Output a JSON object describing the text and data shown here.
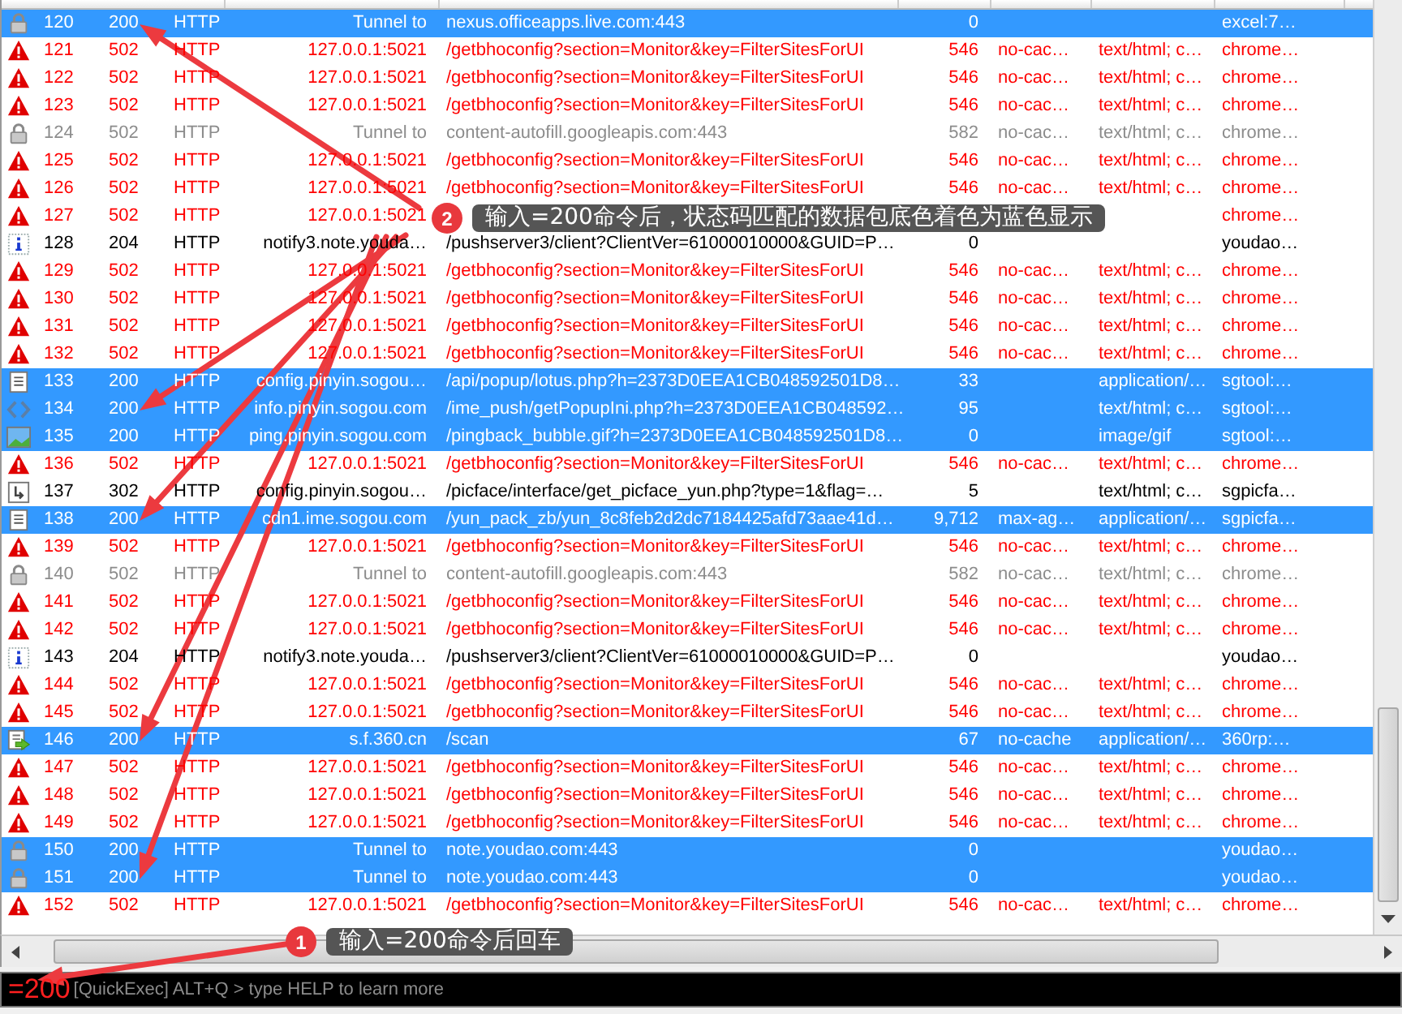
{
  "sessions": [
    {
      "kind": "lock",
      "error": false,
      "dimmed": false,
      "selected": true,
      "id": "120",
      "result": "200",
      "protocol": "HTTP",
      "host": "Tunnel to",
      "url": "nexus.officeapps.live.com:443",
      "body": "0",
      "process": "excel:7…"
    },
    {
      "kind": "warning",
      "error": true,
      "dimmed": false,
      "selected": false,
      "id": "121",
      "result": "502",
      "protocol": "HTTP",
      "host": "127.0.0.1:5021",
      "url": "/getbhoconfig?section=Monitor&key=FilterSitesForUI",
      "body": "546",
      "caching": "no-cac…",
      "content_type": "text/html; c…",
      "process": "chrome…"
    },
    {
      "kind": "warning",
      "error": true,
      "dimmed": false,
      "selected": false,
      "id": "122",
      "result": "502",
      "protocol": "HTTP",
      "host": "127.0.0.1:5021",
      "url": "/getbhoconfig?section=Monitor&key=FilterSitesForUI",
      "body": "546",
      "caching": "no-cac…",
      "content_type": "text/html; c…",
      "process": "chrome…"
    },
    {
      "kind": "warning",
      "error": true,
      "dimmed": false,
      "selected": false,
      "id": "123",
      "result": "502",
      "protocol": "HTTP",
      "host": "127.0.0.1:5021",
      "url": "/getbhoconfig?section=Monitor&key=FilterSitesForUI",
      "body": "546",
      "caching": "no-cac…",
      "content_type": "text/html; c…",
      "process": "chrome…"
    },
    {
      "kind": "lock",
      "error": false,
      "dimmed": true,
      "selected": false,
      "id": "124",
      "result": "502",
      "protocol": "HTTP",
      "host": "Tunnel to",
      "url": "content-autofill.googleapis.com:443",
      "body": "582",
      "caching": "no-cac…",
      "content_type": "text/html; c…",
      "process": "chrome…"
    },
    {
      "kind": "warning",
      "error": true,
      "dimmed": false,
      "selected": false,
      "id": "125",
      "result": "502",
      "protocol": "HTTP",
      "host": "127.0.0.1:5021",
      "url": "/getbhoconfig?section=Monitor&key=FilterSitesForUI",
      "body": "546",
      "caching": "no-cac…",
      "content_type": "text/html; c…",
      "process": "chrome…"
    },
    {
      "kind": "warning",
      "error": true,
      "dimmed": false,
      "selected": false,
      "id": "126",
      "result": "502",
      "protocol": "HTTP",
      "host": "127.0.0.1:5021",
      "url": "/getbhoconfig?section=Monitor&key=FilterSitesForUI",
      "body": "546",
      "caching": "no-cac…",
      "content_type": "text/html; c…",
      "process": "chrome…"
    },
    {
      "kind": "warning",
      "error": true,
      "dimmed": false,
      "selected": false,
      "id": "127",
      "result": "502",
      "protocol": "HTTP",
      "host": "127.0.0.1:5021",
      "process": "chrome…"
    },
    {
      "kind": "info",
      "error": false,
      "dimmed": false,
      "selected": false,
      "id": "128",
      "result": "204",
      "protocol": "HTTP",
      "host": "notify3.note.youda…",
      "url": "/pushserver3/client?ClientVer=61000010000&GUID=P…",
      "body": "0",
      "process": "youdao…"
    },
    {
      "kind": "warning",
      "error": true,
      "dimmed": false,
      "selected": false,
      "id": "129",
      "result": "502",
      "protocol": "HTTP",
      "host": "127.0.0.1:5021",
      "url": "/getbhoconfig?section=Monitor&key=FilterSitesForUI",
      "body": "546",
      "caching": "no-cac…",
      "content_type": "text/html; c…",
      "process": "chrome…"
    },
    {
      "kind": "warning",
      "error": true,
      "dimmed": false,
      "selected": false,
      "id": "130",
      "result": "502",
      "protocol": "HTTP",
      "host": "127.0.0.1:5021",
      "url": "/getbhoconfig?section=Monitor&key=FilterSitesForUI",
      "body": "546",
      "caching": "no-cac…",
      "content_type": "text/html; c…",
      "process": "chrome…"
    },
    {
      "kind": "warning",
      "error": true,
      "dimmed": false,
      "selected": false,
      "id": "131",
      "result": "502",
      "protocol": "HTTP",
      "host": "127.0.0.1:5021",
      "url": "/getbhoconfig?section=Monitor&key=FilterSitesForUI",
      "body": "546",
      "caching": "no-cac…",
      "content_type": "text/html; c…",
      "process": "chrome…"
    },
    {
      "kind": "warning",
      "error": true,
      "dimmed": false,
      "selected": false,
      "id": "132",
      "result": "502",
      "protocol": "HTTP",
      "host": "127.0.0.1:5021",
      "url": "/getbhoconfig?section=Monitor&key=FilterSitesForUI",
      "body": "546",
      "caching": "no-cac…",
      "content_type": "text/html; c…",
      "process": "chrome…"
    },
    {
      "kind": "document",
      "error": false,
      "dimmed": false,
      "selected": true,
      "id": "133",
      "result": "200",
      "protocol": "HTTP",
      "host": "config.pinyin.sogou…",
      "url": "/api/popup/lotus.php?h=2373D0EEA1CB048592501D8…",
      "body": "33",
      "content_type": "application/…",
      "process": "sgtool:…"
    },
    {
      "kind": "code",
      "error": false,
      "dimmed": false,
      "selected": true,
      "id": "134",
      "result": "200",
      "protocol": "HTTP",
      "host": "info.pinyin.sogou.com",
      "url": "/ime_push/getPopupIni.php?h=2373D0EEA1CB048592…",
      "body": "95",
      "content_type": "text/html; c…",
      "process": "sgtool:…"
    },
    {
      "kind": "image",
      "error": false,
      "dimmed": false,
      "selected": true,
      "id": "135",
      "result": "200",
      "protocol": "HTTP",
      "host": "ping.pinyin.sogou.com",
      "url": "/pingback_bubble.gif?h=2373D0EEA1CB048592501D8…",
      "body": "0",
      "content_type": "image/gif",
      "process": "sgtool:…"
    },
    {
      "kind": "warning",
      "error": true,
      "dimmed": false,
      "selected": false,
      "id": "136",
      "result": "502",
      "protocol": "HTTP",
      "host": "127.0.0.1:5021",
      "url": "/getbhoconfig?section=Monitor&key=FilterSitesForUI",
      "body": "546",
      "caching": "no-cac…",
      "content_type": "text/html; c…",
      "process": "chrome…"
    },
    {
      "kind": "redirect",
      "error": false,
      "dimmed": false,
      "selected": false,
      "id": "137",
      "result": "302",
      "protocol": "HTTP",
      "host": "config.pinyin.sogou…",
      "url": "/picface/interface/get_picface_yun.php?type=1&flag=…",
      "body": "5",
      "content_type": "text/html; c…",
      "process": "sgpicfa…"
    },
    {
      "kind": "document",
      "error": false,
      "dimmed": false,
      "selected": true,
      "id": "138",
      "result": "200",
      "protocol": "HTTP",
      "host": "cdn1.ime.sogou.com",
      "url": "/yun_pack_zb/yun_8c8feb2d2dc7184425afd73aae41d…",
      "body": "9,712",
      "caching": "max-ag…",
      "content_type": "application/…",
      "process": "sgpicfa…"
    },
    {
      "kind": "warning",
      "error": true,
      "dimmed": false,
      "selected": false,
      "id": "139",
      "result": "502",
      "protocol": "HTTP",
      "host": "127.0.0.1:5021",
      "url": "/getbhoconfig?section=Monitor&key=FilterSitesForUI",
      "body": "546",
      "caching": "no-cac…",
      "content_type": "text/html; c…",
      "process": "chrome…"
    },
    {
      "kind": "lock",
      "error": false,
      "dimmed": true,
      "selected": false,
      "id": "140",
      "result": "502",
      "protocol": "HTTP",
      "host": "Tunnel to",
      "url": "content-autofill.googleapis.com:443",
      "body": "582",
      "caching": "no-cac…",
      "content_type": "text/html; c…",
      "process": "chrome…"
    },
    {
      "kind": "warning",
      "error": true,
      "dimmed": false,
      "selected": false,
      "id": "141",
      "result": "502",
      "protocol": "HTTP",
      "host": "127.0.0.1:5021",
      "url": "/getbhoconfig?section=Monitor&key=FilterSitesForUI",
      "body": "546",
      "caching": "no-cac…",
      "content_type": "text/html; c…",
      "process": "chrome…"
    },
    {
      "kind": "warning",
      "error": true,
      "dimmed": false,
      "selected": false,
      "id": "142",
      "result": "502",
      "protocol": "HTTP",
      "host": "127.0.0.1:5021",
      "url": "/getbhoconfig?section=Monitor&key=FilterSitesForUI",
      "body": "546",
      "caching": "no-cac…",
      "content_type": "text/html; c…",
      "process": "chrome…"
    },
    {
      "kind": "info",
      "error": false,
      "dimmed": false,
      "selected": false,
      "id": "143",
      "result": "204",
      "protocol": "HTTP",
      "host": "notify3.note.youda…",
      "url": "/pushserver3/client?ClientVer=61000010000&GUID=P…",
      "body": "0",
      "process": "youdao…"
    },
    {
      "kind": "warning",
      "error": true,
      "dimmed": false,
      "selected": false,
      "id": "144",
      "result": "502",
      "protocol": "HTTP",
      "host": "127.0.0.1:5021",
      "url": "/getbhoconfig?section=Monitor&key=FilterSitesForUI",
      "body": "546",
      "caching": "no-cac…",
      "content_type": "text/html; c…",
      "process": "chrome…"
    },
    {
      "kind": "warning",
      "error": true,
      "dimmed": false,
      "selected": false,
      "id": "145",
      "result": "502",
      "protocol": "HTTP",
      "host": "127.0.0.1:5021",
      "url": "/getbhoconfig?section=Monitor&key=FilterSitesForUI",
      "body": "546",
      "caching": "no-cac…",
      "content_type": "text/html; c…",
      "process": "chrome…"
    },
    {
      "kind": "script",
      "error": false,
      "dimmed": false,
      "selected": true,
      "id": "146",
      "result": "200",
      "protocol": "HTTP",
      "host": "s.f.360.cn",
      "url": "/scan",
      "body": "67",
      "caching": "no-cache",
      "content_type": "application/…",
      "process": "360rp:…"
    },
    {
      "kind": "warning",
      "error": true,
      "dimmed": false,
      "selected": false,
      "id": "147",
      "result": "502",
      "protocol": "HTTP",
      "host": "127.0.0.1:5021",
      "url": "/getbhoconfig?section=Monitor&key=FilterSitesForUI",
      "body": "546",
      "caching": "no-cac…",
      "content_type": "text/html; c…",
      "process": "chrome…"
    },
    {
      "kind": "warning",
      "error": true,
      "dimmed": false,
      "selected": false,
      "id": "148",
      "result": "502",
      "protocol": "HTTP",
      "host": "127.0.0.1:5021",
      "url": "/getbhoconfig?section=Monitor&key=FilterSitesForUI",
      "body": "546",
      "caching": "no-cac…",
      "content_type": "text/html; c…",
      "process": "chrome…"
    },
    {
      "kind": "warning",
      "error": true,
      "dimmed": false,
      "selected": false,
      "id": "149",
      "result": "502",
      "protocol": "HTTP",
      "host": "127.0.0.1:5021",
      "url": "/getbhoconfig?section=Monitor&key=FilterSitesForUI",
      "body": "546",
      "caching": "no-cac…",
      "content_type": "text/html; c…",
      "process": "chrome…"
    },
    {
      "kind": "lock",
      "error": false,
      "dimmed": false,
      "selected": true,
      "id": "150",
      "result": "200",
      "protocol": "HTTP",
      "host": "Tunnel to",
      "url": "note.youdao.com:443",
      "body": "0",
      "process": "youdao…"
    },
    {
      "kind": "lock",
      "error": false,
      "dimmed": false,
      "selected": true,
      "id": "151",
      "result": "200",
      "protocol": "HTTP",
      "host": "Tunnel to",
      "url": "note.youdao.com:443",
      "body": "0",
      "process": "youdao…"
    },
    {
      "kind": "warning",
      "error": true,
      "dimmed": false,
      "selected": false,
      "id": "152",
      "result": "502",
      "protocol": "HTTP",
      "host": "127.0.0.1:5021",
      "url": "/getbhoconfig?section=Monitor&key=FilterSitesForUI",
      "body": "546",
      "caching": "no-cac…",
      "content_type": "text/html; c…",
      "process": "chrome…"
    }
  ],
  "quickexec": {
    "value": "=200",
    "hint": "[QuickExec] ALT+Q > type HELP to learn more"
  },
  "callouts": [
    {
      "number": "2",
      "text": "输入=200命令后，状态码匹配的数据包底色着色为蓝色显示"
    },
    {
      "number": "1",
      "text": "输入=200命令后回车"
    }
  ]
}
